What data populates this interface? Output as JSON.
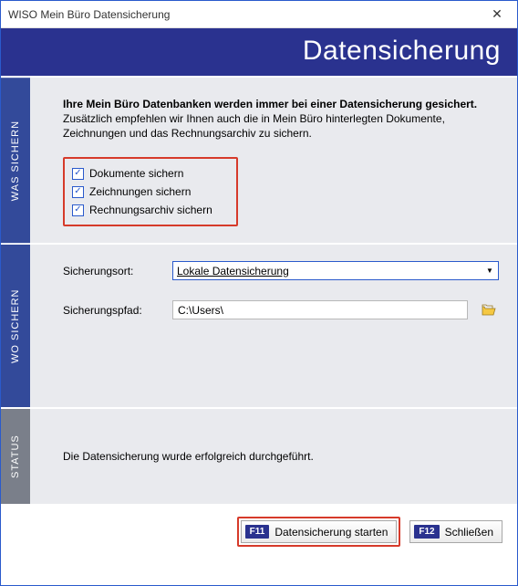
{
  "window": {
    "title": "WISO Mein Büro Datensicherung"
  },
  "header": {
    "title": "Datensicherung"
  },
  "sections": {
    "was": {
      "tab": "WAS SICHERN",
      "intro_bold": "Ihre Mein Büro Datenbanken werden immer bei einer Datensicherung gesichert.",
      "intro_sub": "Zusätzlich empfehlen wir Ihnen auch die in Mein Büro hinterlegten Dokumente, Zeichnungen und das Rechnungsarchiv zu sichern.",
      "checkboxes": [
        {
          "label": "Dokumente sichern",
          "checked": true
        },
        {
          "label": "Zeichnungen sichern",
          "checked": true
        },
        {
          "label": "Rechnungsarchiv sichern",
          "checked": true
        }
      ]
    },
    "wo": {
      "tab": "WO SICHERN",
      "location_label": "Sicherungsort:",
      "location_value": "Lokale Datensicherung",
      "path_label": "Sicherungspfad:",
      "path_value": "C:\\Users\\"
    },
    "status": {
      "tab": "STATUS",
      "message": "Die Datensicherung wurde erfolgreich durchgeführt."
    }
  },
  "footer": {
    "start": {
      "fkey": "F11",
      "label": "Datensicherung starten"
    },
    "close": {
      "fkey": "F12",
      "label": "Schließen"
    }
  }
}
